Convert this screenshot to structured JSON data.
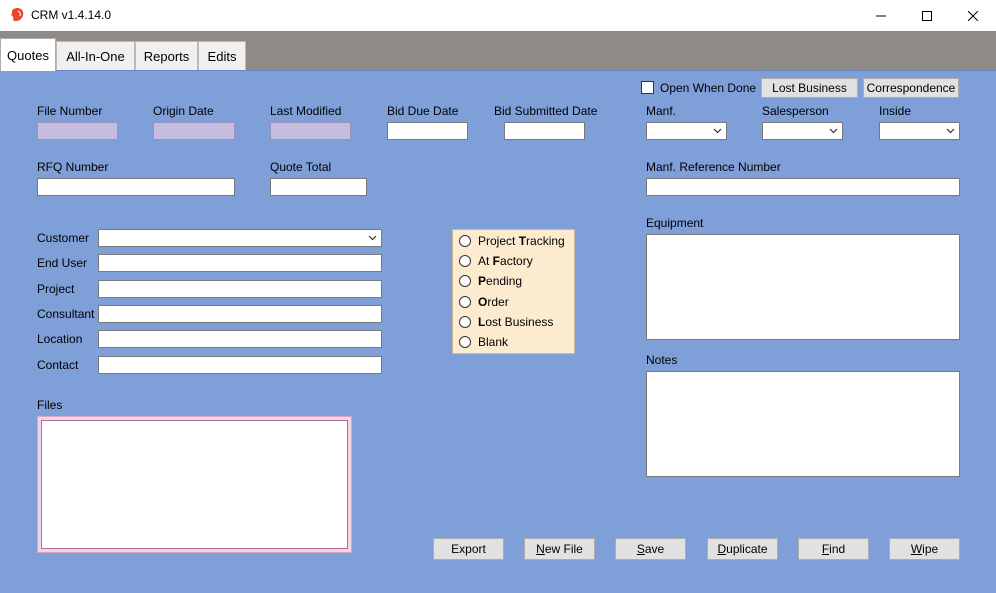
{
  "window": {
    "title": "CRM v1.4.14.0",
    "icon": "app-logo-icon",
    "controls": [
      "minimize-icon",
      "maximize-icon",
      "close-icon"
    ]
  },
  "tabs": [
    {
      "label": "Quotes",
      "active": true
    },
    {
      "label": "All-In-One",
      "active": false
    },
    {
      "label": "Reports",
      "active": false
    },
    {
      "label": "Edits",
      "active": false
    }
  ],
  "top_actions": {
    "open_when_done_label": "Open When Done",
    "open_when_done_checked": false,
    "lost_business_label": "Lost Business",
    "correspondence_label": "Correspondence"
  },
  "fields": {
    "file_number": {
      "label": "File Number",
      "value": ""
    },
    "origin_date": {
      "label": "Origin Date",
      "value": ""
    },
    "last_modified": {
      "label": "Last Modified",
      "value": ""
    },
    "bid_due_date": {
      "label": "Bid Due Date",
      "value": ""
    },
    "bid_submitted_date": {
      "label": "Bid Submitted Date",
      "value": ""
    },
    "manf": {
      "label": "Manf.",
      "value": ""
    },
    "salesperson": {
      "label": "Salesperson",
      "value": ""
    },
    "inside": {
      "label": "Inside",
      "value": ""
    },
    "rfq_number": {
      "label": "RFQ Number",
      "value": ""
    },
    "quote_total": {
      "label": "Quote Total",
      "value": ""
    },
    "manf_reference_number": {
      "label": "Manf. Reference Number",
      "value": ""
    },
    "customer": {
      "label": "Customer",
      "value": ""
    },
    "end_user": {
      "label": "End User",
      "value": ""
    },
    "project": {
      "label": "Project",
      "value": ""
    },
    "consultant": {
      "label": "Consultant",
      "value": ""
    },
    "location": {
      "label": "Location",
      "value": ""
    },
    "contact": {
      "label": "Contact",
      "value": ""
    },
    "equipment": {
      "label": "Equipment",
      "value": ""
    },
    "notes": {
      "label": "Notes",
      "value": ""
    },
    "files": {
      "label": "Files"
    }
  },
  "status_options": [
    {
      "pre": "Project ",
      "key": "T",
      "post": "racking",
      "selected": false
    },
    {
      "pre": "At ",
      "key": "F",
      "post": "actory",
      "selected": false
    },
    {
      "pre": "",
      "key": "P",
      "post": "ending",
      "selected": false
    },
    {
      "pre": "",
      "key": "O",
      "post": "rder",
      "selected": false
    },
    {
      "pre": "",
      "key": "L",
      "post": "ost Business",
      "selected": false
    },
    {
      "pre": "Blank",
      "key": "",
      "post": "",
      "selected": false
    }
  ],
  "bottom_buttons": [
    {
      "pre": "Export",
      "key": "",
      "post": ""
    },
    {
      "pre": "",
      "key": "N",
      "post": "ew File"
    },
    {
      "pre": "",
      "key": "S",
      "post": "ave"
    },
    {
      "pre": "",
      "key": "D",
      "post": "uplicate"
    },
    {
      "pre": "",
      "key": "F",
      "post": "ind"
    },
    {
      "pre": "",
      "key": "W",
      "post": "ipe"
    }
  ],
  "colors": {
    "panel": "#7f9fd9",
    "tabstrip": "#8f8a85",
    "readonly_field": "#c5bde0",
    "status_group": "#fdebd0",
    "files_frame": "#f5d4e8"
  }
}
